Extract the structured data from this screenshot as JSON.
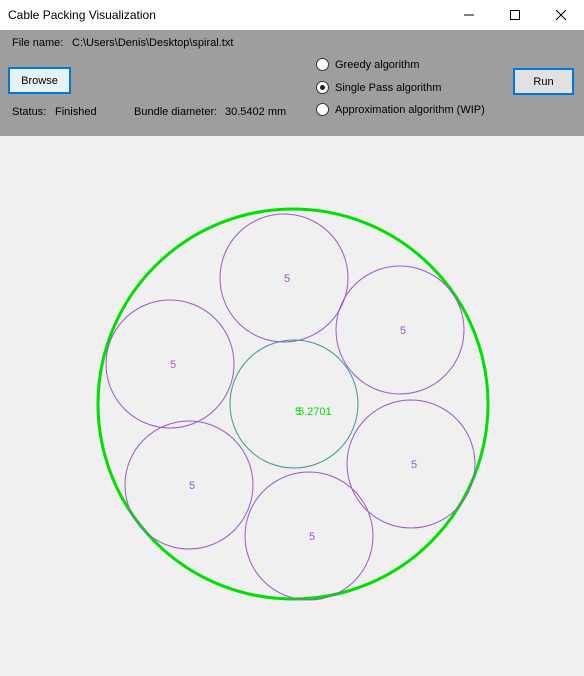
{
  "window": {
    "title": "Cable Packing Visualization"
  },
  "file": {
    "label": "File name:",
    "path": "C:\\Users\\Denis\\Desktop\\spiral.txt"
  },
  "buttons": {
    "browse": "Browse",
    "run": "Run"
  },
  "status": {
    "label": "Status:",
    "value": "Finished"
  },
  "bundle": {
    "label": "Bundle diameter:",
    "value": "30.5402 mm"
  },
  "algorithms": [
    {
      "label": "Greedy algorithm",
      "selected": false
    },
    {
      "label": "Single Pass algorithm",
      "selected": true
    },
    {
      "label": "Approximation algorithm (WIP)",
      "selected": false
    }
  ],
  "visualization": {
    "bundle_color": "#00e000",
    "cable_color": "#9b59c6",
    "center_color": "#3a9a8a",
    "center_labels": {
      "cable": "5",
      "diameter": "5.2701"
    },
    "cables": [
      {
        "label": "5"
      },
      {
        "label": "5"
      },
      {
        "label": "5"
      },
      {
        "label": "5"
      },
      {
        "label": "5"
      },
      {
        "label": "5"
      }
    ]
  }
}
